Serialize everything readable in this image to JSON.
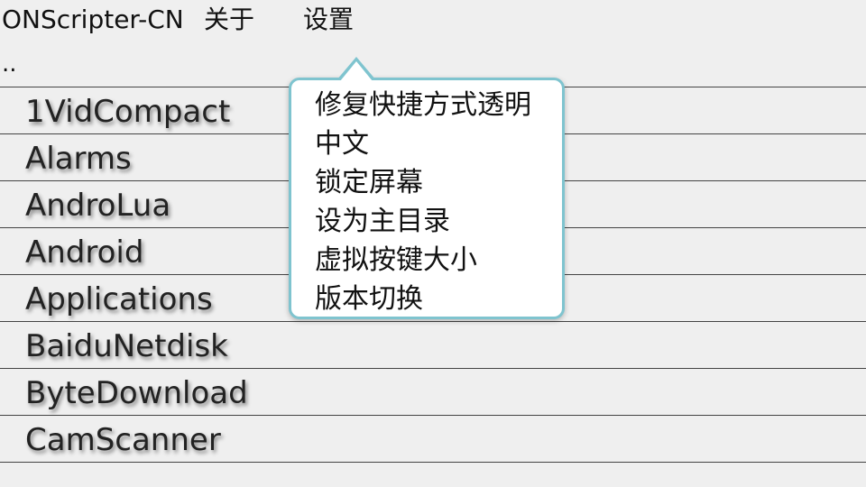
{
  "topbar": {
    "app_title": "ONScripter-CN",
    "about_label": "关于",
    "settings_label": "设置"
  },
  "parent_dir": "..",
  "files": [
    {
      "label": "1VidCompact"
    },
    {
      "label": "Alarms"
    },
    {
      "label": "AndroLua"
    },
    {
      "label": "Android"
    },
    {
      "label": "Applications"
    },
    {
      "label": "BaiduNetdisk"
    },
    {
      "label": "ByteDownload"
    },
    {
      "label": "CamScanner"
    }
  ],
  "settings_menu": {
    "items": [
      {
        "label": "修复快捷方式透明"
      },
      {
        "label": "中文"
      },
      {
        "label": "锁定屏幕"
      },
      {
        "label": "设为主目录"
      },
      {
        "label": "虚拟按键大小"
      },
      {
        "label": "版本切换"
      }
    ]
  }
}
